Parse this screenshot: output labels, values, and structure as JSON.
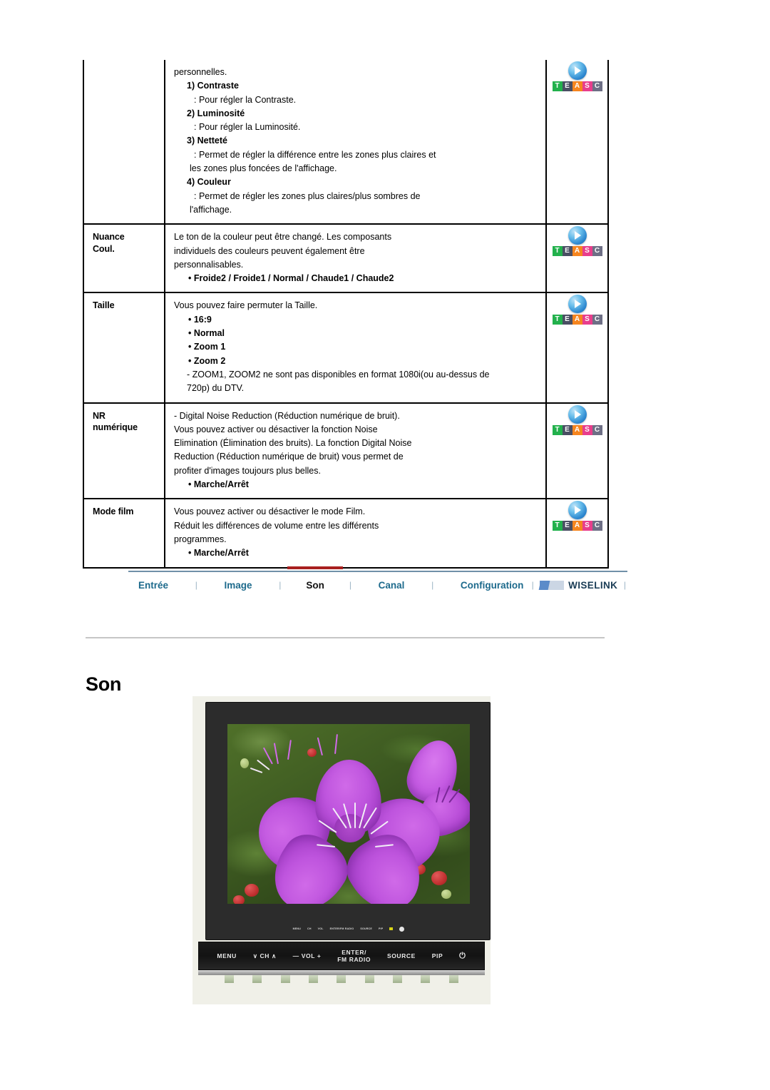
{
  "table": {
    "rows": [
      {
        "label": "",
        "continued": true,
        "lines": [
          {
            "text": "personnelles.",
            "style": "plain"
          },
          {
            "text": "1) Contraste",
            "style": "num"
          },
          {
            "text": ": Pour régler la Contraste.",
            "style": "indent2"
          },
          {
            "text": "2) Luminosité",
            "style": "num"
          },
          {
            "text": ": Pour régler la Luminosité.",
            "style": "indent2"
          },
          {
            "text": "3) Netteté",
            "style": "num"
          },
          {
            "text": ": Permet de régler la différence entre les zones plus claires et",
            "style": "indent2"
          },
          {
            "text": "les zones plus foncées de l'affichage.",
            "style": "indent3"
          },
          {
            "text": "4) Couleur",
            "style": "num"
          },
          {
            "text": ": Permet de régler les zones plus claires/plus sombres de",
            "style": "indent2"
          },
          {
            "text": "l'affichage.",
            "style": "indent3"
          }
        ],
        "icon": "teasc-icon"
      },
      {
        "label": "Nuance\nCoul.",
        "label_line1": "Nuance",
        "label_line2": "Coul.",
        "lines": [
          {
            "text": "Le ton de la couleur peut être changé. Les composants",
            "style": "plain"
          },
          {
            "text": "individuels des couleurs peuvent également être",
            "style": "plain"
          },
          {
            "text": "personnalisables.",
            "style": "plain"
          },
          {
            "text": "• Froide2 / Froide1 / Normal / Chaude1 / Chaude2",
            "style": "bullet"
          }
        ],
        "icon": "teasc-icon"
      },
      {
        "label_line1": "Taille",
        "label_line2": "",
        "lines": [
          {
            "text": "Vous pouvez faire permuter la Taille.",
            "style": "plain"
          },
          {
            "text": "• 16:9",
            "style": "bullet"
          },
          {
            "text": "• Normal",
            "style": "bullet"
          },
          {
            "text": "• Zoom 1",
            "style": "bullet"
          },
          {
            "text": "• Zoom 2",
            "style": "bullet"
          },
          {
            "text": "- ZOOM1, ZOOM2 ne sont pas disponibles en format 1080i(ou au-dessus de",
            "style": "plain"
          },
          {
            "text": "720p) du DTV.",
            "style": "plain"
          }
        ],
        "icon": "teasc-icon"
      },
      {
        "label_line1": "NR",
        "label_line2": "numérique",
        "lines": [
          {
            "text": "- Digital Noise Reduction (Réduction numérique de bruit).",
            "style": "plain"
          },
          {
            "text": "Vous pouvez activer ou désactiver la fonction Noise",
            "style": "plain"
          },
          {
            "text": "Elimination (Élimination des bruits). La fonction Digital Noise",
            "style": "plain"
          },
          {
            "text": "Reduction (Réduction numérique de bruit) vous permet de",
            "style": "plain"
          },
          {
            "text": "profiter d'images toujours plus belles.",
            "style": "plain"
          },
          {
            "text": "• Marche/Arrêt",
            "style": "bullet"
          }
        ],
        "icon": "teasc-icon"
      },
      {
        "label_line1": "Mode film",
        "label_line2": "",
        "lines": [
          {
            "text": "Vous pouvez activer ou désactiver le mode Film.",
            "style": "plain"
          },
          {
            "text": "Réduit les différences de volume entre les différents",
            "style": "plain"
          },
          {
            "text": "programmes.",
            "style": "plain"
          },
          {
            "text": "• Marche/Arrêt",
            "style": "bullet"
          }
        ],
        "icon": "teasc-icon"
      }
    ]
  },
  "teasc": {
    "letters": [
      {
        "char": "T",
        "color": "#22b14c"
      },
      {
        "char": "E",
        "color": "#4a4f63"
      },
      {
        "char": "A",
        "color": "#f5851f"
      },
      {
        "char": "S",
        "color": "#e83e8c"
      },
      {
        "char": "C",
        "color": "#6e6f85"
      }
    ]
  },
  "nav": {
    "items": [
      {
        "label": "Entrée",
        "active": false
      },
      {
        "label": "Image",
        "active": false
      },
      {
        "label": "Son",
        "active": true
      },
      {
        "label": "Canal",
        "active": false
      },
      {
        "label": "Configuration",
        "active": false
      }
    ],
    "separator": "|",
    "logo": "mediaplay-logo",
    "wiselink": "WISELINK",
    "accent_active": "#a8201f",
    "accent_link": "#1d6a8c"
  },
  "heading": {
    "title": "Son"
  },
  "monitor": {
    "controls": [
      {
        "label": "MENU"
      },
      {
        "label": "CH",
        "prefix": "∨",
        "suffix": "∧"
      },
      {
        "label": "VOL",
        "prefix": "—",
        "suffix": "+"
      },
      {
        "label_line1": "ENTER/",
        "label_line2": "FM RADIO"
      },
      {
        "label": "SOURCE"
      },
      {
        "label": "PIP"
      },
      {
        "label": "⏻"
      }
    ],
    "bezel_labels": [
      "MENU",
      "CH",
      "VOL",
      "ENTER/FM RADIO",
      "SOURCE",
      "PIP"
    ],
    "screen_content": "flower-photo"
  }
}
